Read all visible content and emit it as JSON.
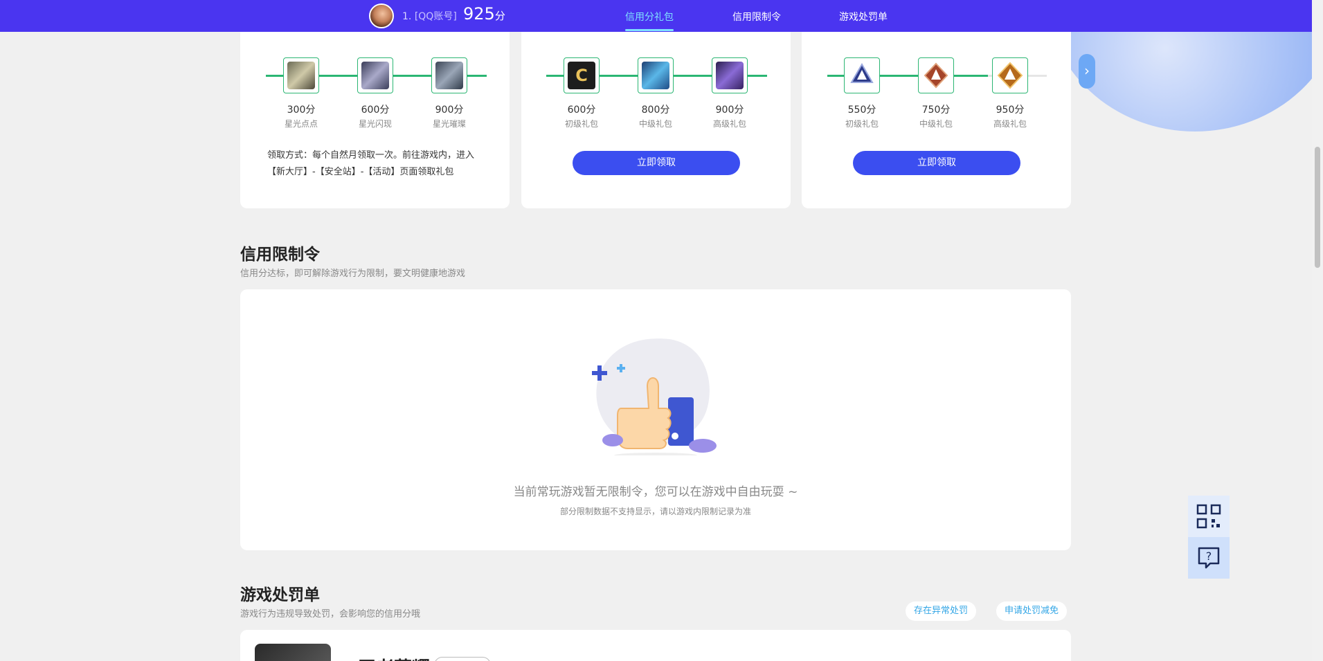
{
  "header": {
    "rank": "1.",
    "account": "[QQ账号]",
    "score": "925",
    "score_unit": "分",
    "tabs": [
      {
        "label": "信用分礼包",
        "active": true
      },
      {
        "label": "信用限制令",
        "active": false
      },
      {
        "label": "游戏处罚单",
        "active": false
      }
    ]
  },
  "gift_cards": [
    {
      "items": [
        {
          "score": "300分",
          "name": "星光点点"
        },
        {
          "score": "600分",
          "name": "星光闪现"
        },
        {
          "score": "900分",
          "name": "星光璀璨"
        }
      ],
      "claim_text": "领取方式：每个自然月领取一次。前往游戏内，进入【新大厅】-【安全站】-【活动】页面领取礼包"
    },
    {
      "items": [
        {
          "score": "600分",
          "name": "初级礼包"
        },
        {
          "score": "800分",
          "name": "中级礼包"
        },
        {
          "score": "900分",
          "name": "高级礼包"
        }
      ],
      "button": "立即领取"
    },
    {
      "items": [
        {
          "score": "550分",
          "name": "初级礼包"
        },
        {
          "score": "750分",
          "name": "中级礼包"
        },
        {
          "score": "950分",
          "name": "高级礼包"
        }
      ],
      "button": "立即领取"
    }
  ],
  "restrictions": {
    "title": "信用限制令",
    "subtitle": "信用分达标，即可解除游戏行为限制，要文明健康地游戏",
    "empty_message": "当前常玩游戏暂无限制令，您可以在游戏中自由玩耍 ~",
    "empty_note": "部分限制数据不支持显示，请以游戏内限制记录为准"
  },
  "penalties": {
    "title": "游戏处罚单",
    "subtitle": "游戏行为违规导致处罚，会影响您的信用分哦",
    "btn_abnormal": "存在异常处罚",
    "btn_appeal": "申请处罚减免",
    "first_game_title": "王者荣耀"
  },
  "colors": {
    "topbar": "#4a35f0",
    "accent": "#3b4ef0",
    "track": "#2bb673",
    "link": "#33a6e6"
  }
}
